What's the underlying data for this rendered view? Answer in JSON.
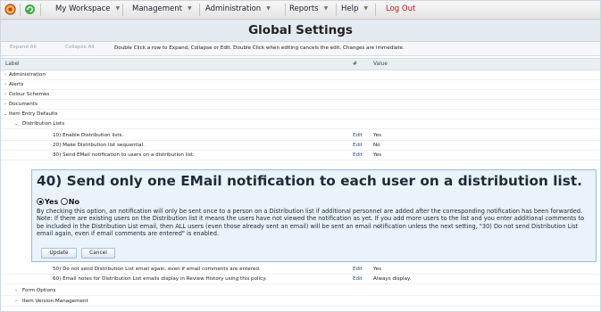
{
  "nav": {
    "menus": [
      {
        "label": "My Workspace"
      },
      {
        "label": "Management"
      },
      {
        "label": "Administration"
      },
      {
        "label": "Reports"
      },
      {
        "label": "Help"
      }
    ],
    "logout": "Log Out"
  },
  "page": {
    "title": "Global Settings"
  },
  "toolbar": {
    "expand_all": "Expand All",
    "collapse_all": "Collapse All",
    "hint": "Double Click a row to Expand, Collapse or Edit. Double Click when editing cancels the edit. Changes are immediate."
  },
  "table": {
    "headers": {
      "label": "Label",
      "num": "#",
      "value": "Value"
    },
    "categories": [
      "Administration",
      "Alerts",
      "Colour Schemes",
      "Documents",
      "Item Entry Defaults"
    ],
    "subcategory": "Distribution Lists",
    "rows_before": [
      {
        "label": "10) Enable Distribution lists.",
        "action": "Edit",
        "value": "Yes"
      },
      {
        "label": "20) Make Distribution list sequential.",
        "action": "Edit",
        "value": "No"
      },
      {
        "label": "30) Send EMail notification to users on a distribution list.",
        "action": "Edit",
        "value": "Yes"
      }
    ],
    "rows_after": [
      {
        "label": "50) Do not send Distribution List email again, even if email comments are entered.",
        "action": "Edit",
        "value": "Yes"
      },
      {
        "label": "60) Email notes for Distribution List emails display in Review History using this policy.",
        "action": "Edit",
        "value": "Always display."
      }
    ],
    "trailing_categories": [
      "Form Options",
      "Item Version Management"
    ]
  },
  "editor": {
    "title": "40) Send only one EMail notification to each user on a distribution list.",
    "option_yes": "Yes",
    "option_no": "No",
    "selected": "Yes",
    "description": "By checking this option, an notification will only be sent once to a person on a Distribution list if additional personnel are added after the corresponding notification has been forwarded. Note: If there are existing users on the Distribution list it means the users have not viewed the notification as yet. If you add more users to the list and you enter additional comments to be included in the Distribution List email, then ALL users (even those already sent an email) will be sent an email notification unless the next setting, \"30) Do not send Distribution List email again, even if email comments are entered\" is enabled.",
    "update_label": "Update",
    "cancel_label": "Cancel"
  },
  "colors": {
    "accent": "#2b4a6f",
    "logout": "#cc1111",
    "editor_bg": "#eaf3fb"
  }
}
